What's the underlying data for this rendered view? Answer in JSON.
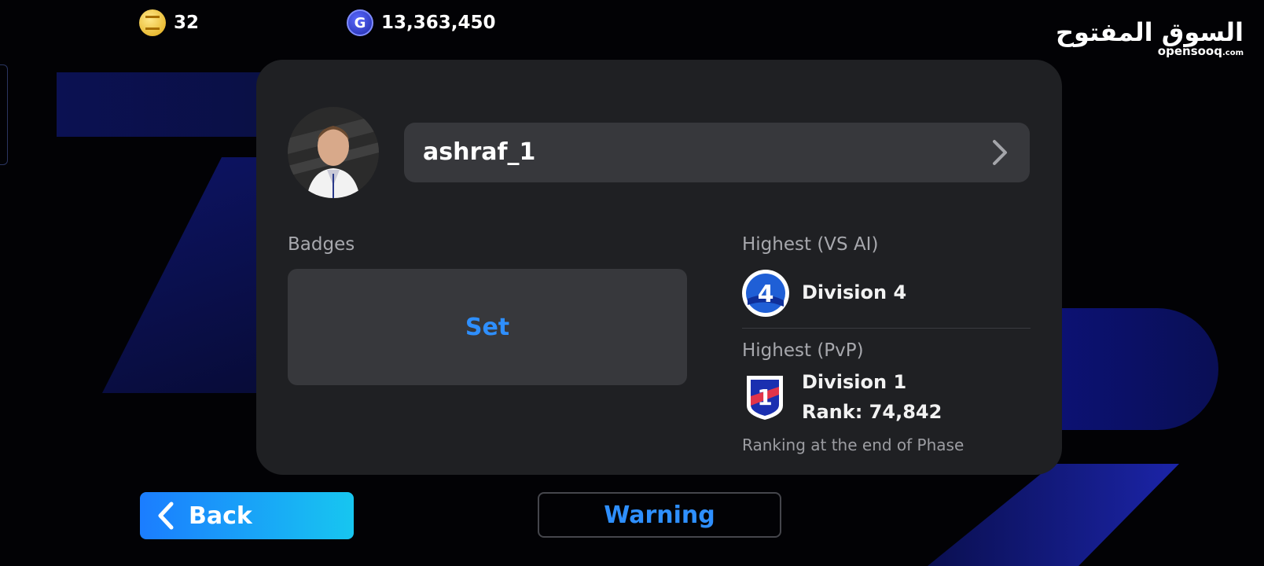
{
  "currencies": {
    "coins": {
      "icon": "gold-coin-icon",
      "value": "32"
    },
    "gp": {
      "icon": "gp-coin-icon",
      "value": "13,363,450"
    }
  },
  "watermark": {
    "arabic": "السوق المفتوح",
    "latin": "opensooq",
    "suffix": ".com"
  },
  "profile": {
    "avatar": "player-avatar",
    "username": "ashraf_1"
  },
  "badges": {
    "label": "Badges",
    "set_label": "Set"
  },
  "highest_vs_ai": {
    "label": "Highest (VS AI)",
    "division": "Division 4",
    "division_number": "4"
  },
  "highest_pvp": {
    "label": "Highest (PvP)",
    "division": "Division 1",
    "division_number": "1",
    "rank": "Rank: 74,842",
    "note": "Ranking at the end of Phase"
  },
  "buttons": {
    "back": "Back",
    "warning": "Warning"
  },
  "colors": {
    "accent_blue": "#2e8fff",
    "panel": "#1f2023",
    "field": "#37383c",
    "back_start": "#1b7dff",
    "back_end": "#17c6f0"
  }
}
